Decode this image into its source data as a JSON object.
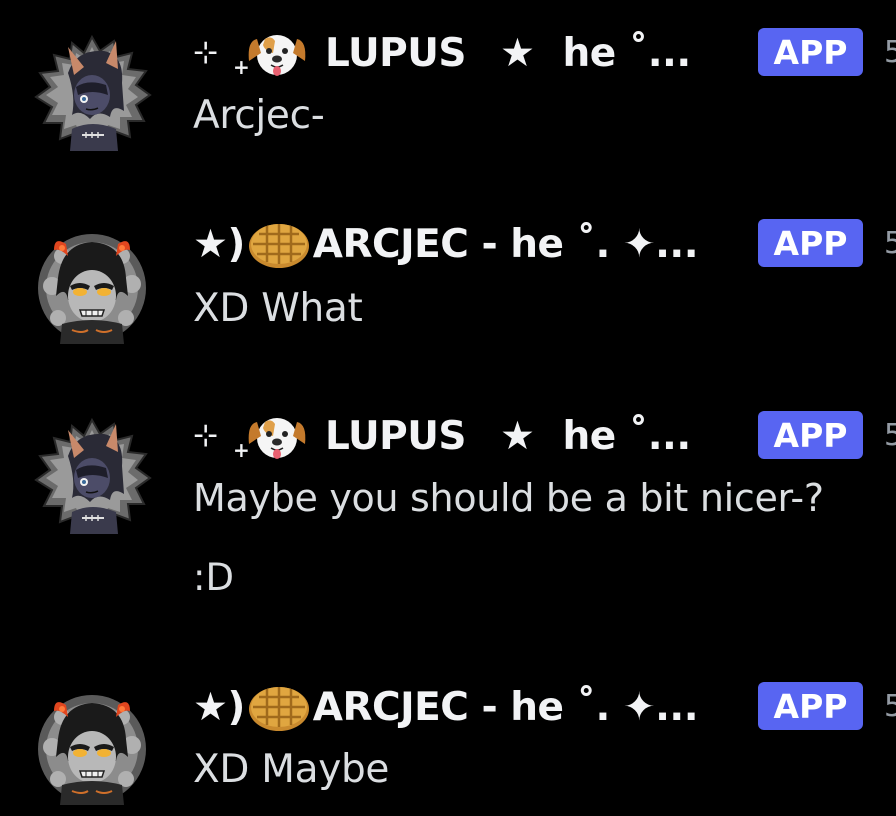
{
  "messages": [
    {
      "author": "LUPUS",
      "author_prefix_sparkle": "⊹",
      "author_prefix_plus": "+",
      "author_star": "★",
      "author_suffix": "he ˚...",
      "badge": "APP",
      "timestamp": "5",
      "text": "Arcjec-",
      "avatar_icon": "lupus-avatar"
    },
    {
      "author_prefix": "★)",
      "author": "ARCJEC - he ˚. ✦...",
      "badge": "APP",
      "timestamp": "5",
      "text": "XD What",
      "avatar_icon": "arcjec-avatar"
    },
    {
      "author": "LUPUS",
      "author_prefix_sparkle": "⊹",
      "author_prefix_plus": "+",
      "author_star": "★",
      "author_suffix": "he ˚...",
      "badge": "APP",
      "timestamp": "5",
      "text": "Maybe you should be a bit nicer-?",
      "text_extra": ":D",
      "avatar_icon": "lupus-avatar"
    },
    {
      "author_prefix": "★)",
      "author": "ARCJEC - he ˚. ✦...",
      "badge": "APP",
      "timestamp": "5",
      "text": "XD Maybe",
      "avatar_icon": "arcjec-avatar"
    }
  ],
  "colors": {
    "background": "#000000",
    "username": "#f2f3f5",
    "message_text": "#dbdee1",
    "app_badge": "#5865f2",
    "timestamp": "#949ba4"
  }
}
